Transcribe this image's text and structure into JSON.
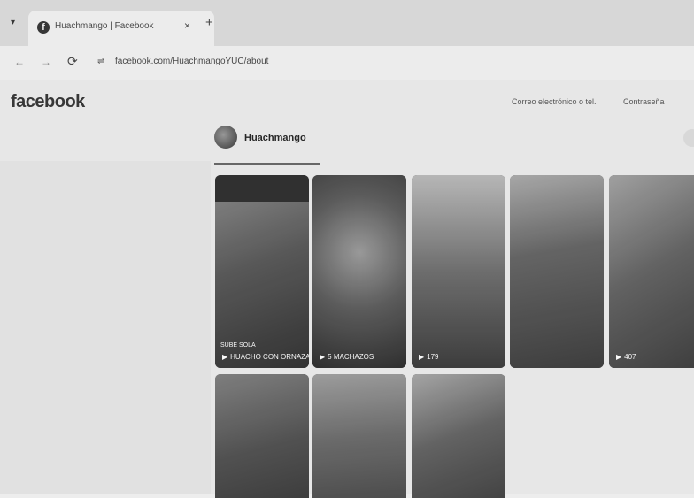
{
  "browser": {
    "tab_title": "Huachmango | Facebook",
    "tab_icon": "facebook-icon",
    "new_tab": "+",
    "close_tab": "×",
    "url": "facebook.com/HuachmangoYUC/about"
  },
  "header": {
    "logo": "facebook",
    "email_placeholder": "Correo electrónico o tel.",
    "password_placeholder": "Contraseña"
  },
  "profile": {
    "name": "Huachmango"
  },
  "reels": [
    {
      "label": "HUACHO CON ORNAZA"
    },
    {
      "label": "5 MACHAZOS"
    },
    {
      "label": "179"
    },
    {
      "label": ""
    },
    {
      "label": "407"
    },
    {
      "label": ""
    },
    {
      "label": ""
    },
    {
      "label": ""
    }
  ],
  "reel_extra": "SUBE SOLA"
}
